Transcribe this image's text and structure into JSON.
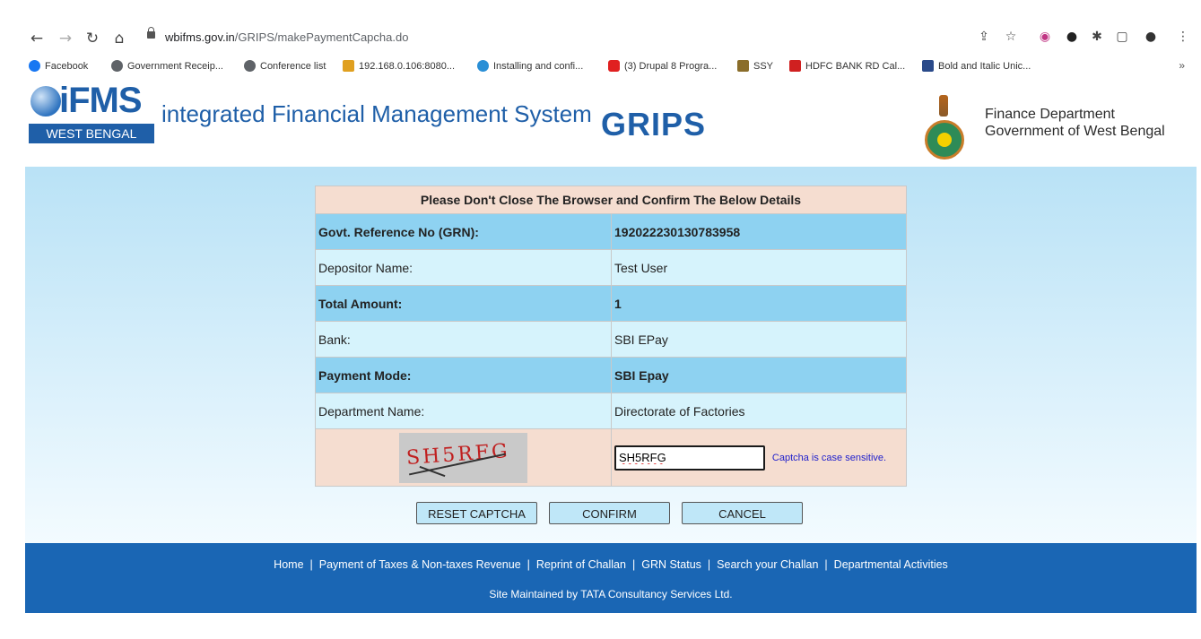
{
  "browser": {
    "url_host": "wbifms.gov.in",
    "url_path": "/GRIPS/makePaymentCapcha.do",
    "bookmarks": [
      {
        "label": "Facebook",
        "color": "#1877f2"
      },
      {
        "label": "Government Receip...",
        "color": "#5f6368"
      },
      {
        "label": "Conference list",
        "color": "#5f6368"
      },
      {
        "label": "192.168.0.106:8080...",
        "color": "#e0a020"
      },
      {
        "label": "Installing and confi...",
        "color": "#2a8fd6"
      },
      {
        "label": "(3) Drupal 8 Progra...",
        "color": "#e02020"
      },
      {
        "label": "SSY",
        "color": "#8a6d2a"
      },
      {
        "label": "HDFC BANK RD Cal...",
        "color": "#d02020"
      },
      {
        "label": "Bold and Italic Unic...",
        "color": "#2a4a8a"
      }
    ],
    "more": "»"
  },
  "header": {
    "logo_word": "iFMS",
    "logo_band": "WEST BENGAL",
    "title": "integrated Financial Management System",
    "grips": "GRIPS",
    "dept_line1": "Finance Department",
    "dept_line2": "Government of West Bengal"
  },
  "details": {
    "heading": "Please Don't Close The Browser and Confirm The Below Details",
    "rows": [
      {
        "label": "Govt. Reference No (GRN):",
        "value": "192022230130783958"
      },
      {
        "label": "Depositor Name:",
        "value": "Test User"
      },
      {
        "label": "Total Amount:",
        "value": "1"
      },
      {
        "label": "Bank:",
        "value": "SBI EPay"
      },
      {
        "label": "Payment Mode:",
        "value": "SBI Epay"
      },
      {
        "label": "Department Name:",
        "value": "Directorate of Factories"
      }
    ],
    "captcha_image_text": "SH5RFG",
    "captcha_value": "SH5RFG",
    "captcha_note": "Captcha is case sensitive."
  },
  "buttons": {
    "reset": "RESET CAPTCHA",
    "confirm": "CONFIRM",
    "cancel": "CANCEL"
  },
  "footer": {
    "links": [
      "Home",
      "Payment of Taxes & Non-taxes Revenue",
      "Reprint of Challan",
      "GRN Status",
      "Search your Challan",
      "Departmental Activities"
    ],
    "separator": "|",
    "maintained": "Site Maintained by TATA Consultancy Services Ltd."
  }
}
